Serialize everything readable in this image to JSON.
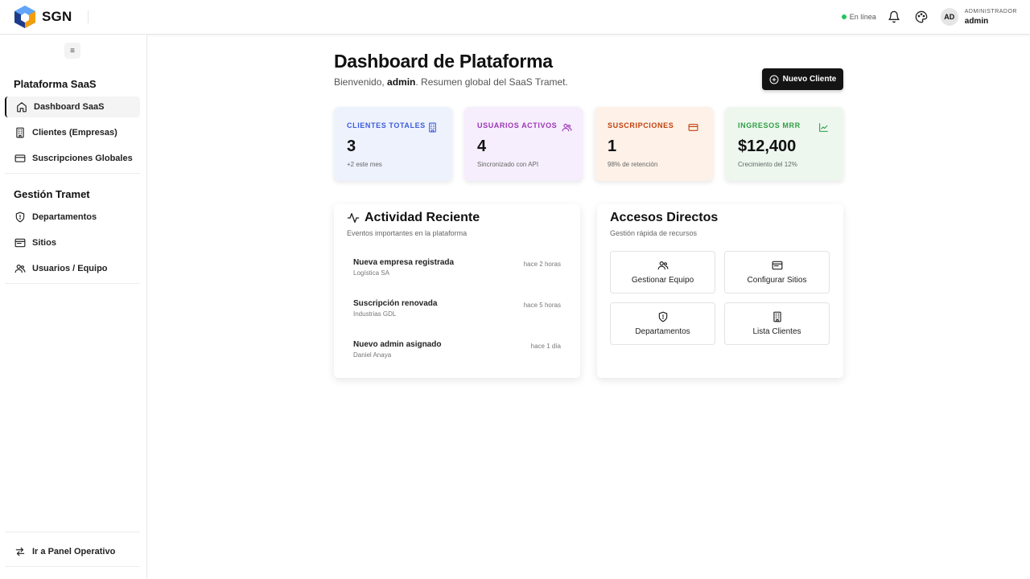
{
  "brand": {
    "name": "SGN"
  },
  "topbar": {
    "status": "En línea",
    "avatar_initials": "AD",
    "user_role": "ADMINISTRADOR",
    "user_name": "admin"
  },
  "sidebar": {
    "collapse_glyph": "≡",
    "sections": [
      {
        "title": "Plataforma SaaS",
        "items": [
          {
            "label": "Dashboard SaaS",
            "icon": "home-icon",
            "active": true
          },
          {
            "label": "Clientes (Empresas)",
            "icon": "building-icon",
            "active": false
          },
          {
            "label": "Suscripciones Globales",
            "icon": "credit-card-icon",
            "active": false
          }
        ]
      },
      {
        "title": "Gestión Tramet",
        "items": [
          {
            "label": "Departamentos",
            "icon": "shield-icon",
            "active": false
          },
          {
            "label": "Sitios",
            "icon": "browser-window-icon",
            "active": false
          },
          {
            "label": "Usuarios / Equipo",
            "icon": "users-icon",
            "active": false
          }
        ]
      }
    ],
    "footer": {
      "label": "Ir a Panel Operativo",
      "icon": "swap-arrows-icon"
    }
  },
  "header": {
    "title": "Dashboard de Plataforma",
    "subtitle_pre": "Bienvenido, ",
    "subtitle_user": "admin",
    "subtitle_post": ". Resumen global del SaaS Tramet.",
    "new_button": "Nuevo Cliente"
  },
  "stats": [
    {
      "label": "CLIENTES TOTALES",
      "value": "3",
      "note": "+2 este mes",
      "icon": "building-icon",
      "accent": "#3b5bdb",
      "bg": "#eef2fd"
    },
    {
      "label": "USUARIOS ACTIVOS",
      "value": "4",
      "note": "Sincronizado con API",
      "icon": "users-icon",
      "accent": "#9c36b5",
      "bg": "#f6eefd"
    },
    {
      "label": "SUSCRIPCIONES",
      "value": "1",
      "note": "98% de retención",
      "icon": "credit-card-icon",
      "accent": "#c2410c",
      "bg": "#fdf1e8"
    },
    {
      "label": "INGRESOS MRR",
      "value": "$12,400",
      "note": "Crecimiento del 12%",
      "icon": "trend-up-icon",
      "accent": "#2f9e44",
      "bg": "#edf7ee"
    }
  ],
  "activity": {
    "title": "Actividad Reciente",
    "subtitle": "Eventos importantes en la plataforma",
    "items": [
      {
        "title": "Nueva empresa registrada",
        "detail": "Logística SA",
        "time": "hace 2 horas"
      },
      {
        "title": "Suscripción renovada",
        "detail": "Industrias GDL",
        "time": "hace 5 horas"
      },
      {
        "title": "Nuevo admin asignado",
        "detail": "Daniel Anaya",
        "time": "hace 1 día"
      }
    ]
  },
  "shortcuts": {
    "title": "Accesos Directos",
    "subtitle": "Gestión rápida de recursos",
    "items": [
      {
        "label": "Gestionar Equipo",
        "icon": "users-icon"
      },
      {
        "label": "Configurar Sitios",
        "icon": "browser-window-icon"
      },
      {
        "label": "Departamentos",
        "icon": "shield-icon"
      },
      {
        "label": "Lista Clientes",
        "icon": "building-icon"
      }
    ]
  }
}
